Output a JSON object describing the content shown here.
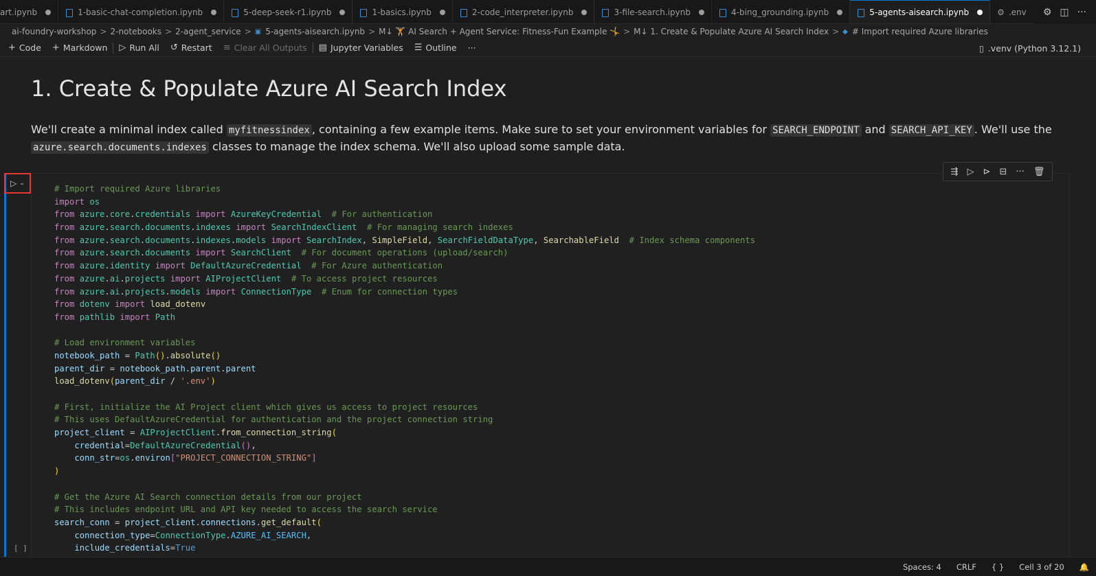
{
  "tabs": [
    {
      "label": "art.ipynb",
      "active": false
    },
    {
      "label": "1-basic-chat-completion.ipynb",
      "active": false
    },
    {
      "label": "5-deep-seek-r1.ipynb",
      "active": false
    },
    {
      "label": "1-basics.ipynb",
      "active": false
    },
    {
      "label": "2-code_interpreter.ipynb",
      "active": false
    },
    {
      "label": "3-file-search.ipynb",
      "active": false
    },
    {
      "label": "4-bing_grounding.ipynb",
      "active": false
    },
    {
      "label": "5-agents-aisearch.ipynb",
      "active": true
    },
    {
      "label": ".env",
      "active": false
    }
  ],
  "breadcrumb": {
    "items": [
      "ai-foundry-workshop",
      "2-notebooks",
      "2-agent_service",
      "5-agents-aisearch.ipynb",
      "M↓ 🏋 AI Search + Agent Service: Fitness-Fun Example 🤸",
      "M↓ 1. Create & Populate Azure AI Search Index",
      "# Import required Azure libraries"
    ]
  },
  "toolbar": {
    "code": "Code",
    "markdown": "Markdown",
    "run_all": "Run All",
    "restart": "Restart",
    "clear_outputs": "Clear All Outputs",
    "variables": "Jupyter Variables",
    "outline": "Outline",
    "more": "···",
    "kernel": ".venv (Python 3.12.1)"
  },
  "markdown": {
    "heading": "1. Create & Populate Azure AI Search Index",
    "p1": "We'll create a minimal index called ",
    "code1": "myfitnessindex",
    "p2": ", containing a few example items. Make sure to set your environment variables for ",
    "code2": "SEARCH_ENDPOINT",
    "p3": " and ",
    "code3": "SEARCH_API_KEY",
    "p4": ". We'll use the ",
    "code4": "azure.search.documents.indexes",
    "p5": " classes to manage the index schema. We'll also upload some sample data."
  },
  "cell": {
    "exec_count": "[ ]"
  },
  "status": {
    "spaces": "Spaces: 4",
    "eol": "CRLF",
    "lang": "{ }",
    "cell": "Cell 3 of 20"
  },
  "colors": {
    "accent": "#0078d4",
    "highlight_border": "#e53935"
  }
}
